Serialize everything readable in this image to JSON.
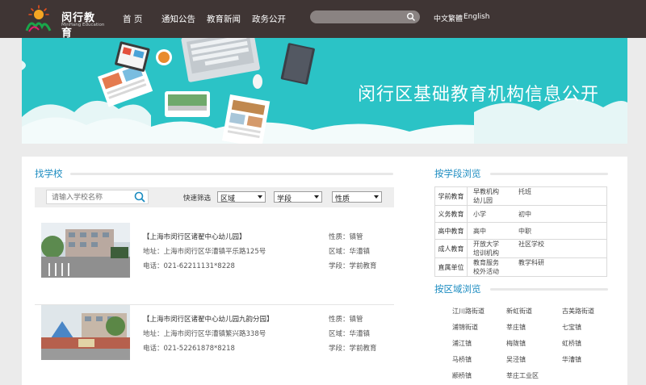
{
  "header": {
    "logo_cn": "闵行教育",
    "logo_en": "MinHang Education",
    "nav": [
      "首 页",
      "通知公告",
      "教育新闻",
      "政务公开"
    ],
    "search_placeholder": "",
    "lang_cn": "中文繁體",
    "lang_en": "English"
  },
  "banner": {
    "title": "闵行区基础教育机构信息公开"
  },
  "find_school": {
    "title": "找学校",
    "search_placeholder": "请输入学校名称",
    "filter_label": "快速筛选",
    "filters": [
      "区域",
      "学段",
      "性质"
    ]
  },
  "labels": {
    "nature": "性质：",
    "region": "区域：",
    "stage": "学段："
  },
  "schools": [
    {
      "name": "【上海市闵行区诸翟中心幼儿园】",
      "address": "地址：上海市闵行区华漕镇平乐路125号",
      "phone": "电话：021-62211131*8228",
      "nature": "镇管",
      "region": "华漕镇",
      "stage": "学前教育"
    },
    {
      "name": "【上海市闵行区诸翟中心幼儿园九韵分园】",
      "address": "地址：上海市闵行区华漕镇繁兴路338号",
      "phone": "电话：021-52261878*8218",
      "nature": "镇管",
      "region": "华漕镇",
      "stage": "学前教育"
    }
  ],
  "by_stage": {
    "title": "按学段浏览",
    "rows": [
      {
        "category": "学前教育",
        "options": [
          "早教机构",
          "托班",
          "幼儿园"
        ]
      },
      {
        "category": "义务教育",
        "options": [
          "小学",
          "初中"
        ]
      },
      {
        "category": "高中教育",
        "options": [
          "高中",
          "中职"
        ]
      },
      {
        "category": "成人教育",
        "options": [
          "开放大学",
          "社区学校",
          "培训机构"
        ]
      },
      {
        "category": "直属单位",
        "options": [
          "教育服务",
          "教学科研",
          "校外活动"
        ]
      }
    ]
  },
  "by_region": {
    "title": "按区域浏览",
    "items": [
      "江川路街道",
      "新虹街道",
      "古美路街道",
      "浦锦街道",
      "莘庄镇",
      "七宝镇",
      "浦江镇",
      "梅陇镇",
      "虹桥镇",
      "马桥镇",
      "吴泾镇",
      "华漕镇",
      "颛桥镇",
      "莘庄工业区"
    ]
  },
  "colors": {
    "header_bg": "#3f3534",
    "accent_blue": "#1a8bc0",
    "banner_teal": "#2bc3c6"
  }
}
